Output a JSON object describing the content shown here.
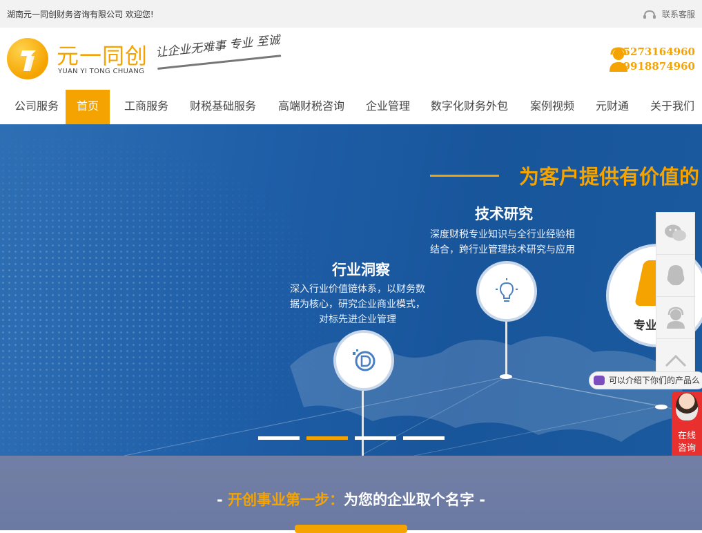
{
  "topbar": {
    "welcome": "湖南元一同创财务咨询有限公司 欢迎您!",
    "service_label": "联系客服"
  },
  "header": {
    "logo_cn": "元一同创",
    "logo_en": "YUAN YI TONG CHUANG",
    "slogan": "让企业无难事 专业 至诚",
    "phones": [
      "15273164960",
      "19918874960"
    ]
  },
  "nav": {
    "items": [
      {
        "label": "公司服务"
      },
      {
        "label": "首页"
      },
      {
        "label": "工商服务"
      },
      {
        "label": "财税基础服务"
      },
      {
        "label": "高端财税咨询"
      },
      {
        "label": "企业管理"
      },
      {
        "label": "数字化财务外包"
      },
      {
        "label": "案例视频"
      },
      {
        "label": "元财通"
      },
      {
        "label": "关于我们"
      }
    ],
    "active_index": 1
  },
  "banner": {
    "headline": "为客户提供有价值的",
    "features": [
      {
        "title": "技术研究",
        "desc": [
          "深度财税专业知识与全行业经验相",
          "结合，跨行业管理技术研究与应用"
        ],
        "icon": "lightbulb-icon"
      },
      {
        "title": "行业洞察",
        "desc": [
          "深入行业价值链体系，以财务数",
          "据为核心，研究企业商业模式，",
          "对标先进企业管理"
        ],
        "icon": "data-d-icon"
      },
      {
        "title": "专业",
        "icon": "brand-logo-icon"
      }
    ],
    "slider_count": 4,
    "slider_active": 1
  },
  "sidebar": {
    "items": [
      {
        "icon": "wechat-icon"
      },
      {
        "icon": "qq-icon"
      },
      {
        "icon": "customer-service-icon"
      },
      {
        "icon": "back-to-top-icon"
      }
    ],
    "chat_text": "可以介绍下你们的产品么",
    "consult_text": [
      "在线",
      "咨询"
    ]
  },
  "section2": {
    "prefix": "- ",
    "highlight": "开创事业第一步：",
    "text": "为您的企业取个名字",
    "suffix": " -"
  },
  "colors": {
    "accent": "#f5a300",
    "banner_blue": "#1f5fa8",
    "consult_red": "#e8312f",
    "section_bg": "#727fa5"
  }
}
